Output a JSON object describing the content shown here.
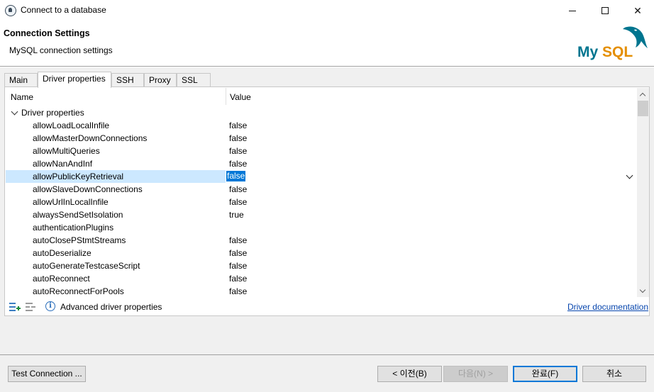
{
  "window": {
    "title": "Connect to a database",
    "minimize_icon": "minimize-icon",
    "maximize_icon": "maximize-icon",
    "close_label": "✕"
  },
  "header": {
    "title": "Connection Settings",
    "subtitle": "MySQL connection settings",
    "logo_text": "MySQL",
    "logo_colors": {
      "my": "#00758f",
      "sql": "#e48e00"
    }
  },
  "tabs": [
    {
      "label": "Main",
      "active": false
    },
    {
      "label": "Driver properties",
      "active": true
    },
    {
      "label": "SSH",
      "active": false
    },
    {
      "label": "Proxy",
      "active": false
    },
    {
      "label": "SSL",
      "active": false
    }
  ],
  "grid": {
    "columns": {
      "name": "Name",
      "value": "Value"
    },
    "group_label": "Driver properties",
    "rows": [
      {
        "name": "allowLoadLocalInfile",
        "value": "false"
      },
      {
        "name": "allowMasterDownConnections",
        "value": "false"
      },
      {
        "name": "allowMultiQueries",
        "value": "false"
      },
      {
        "name": "allowNanAndInf",
        "value": "false"
      },
      {
        "name": "allowPublicKeyRetrieval",
        "value": "false",
        "selected": true
      },
      {
        "name": "allowSlaveDownConnections",
        "value": "false"
      },
      {
        "name": "allowUrlInLocalInfile",
        "value": "false"
      },
      {
        "name": "alwaysSendSetIsolation",
        "value": "true"
      },
      {
        "name": "authenticationPlugins",
        "value": ""
      },
      {
        "name": "autoClosePStmtStreams",
        "value": "false"
      },
      {
        "name": "autoDeserialize",
        "value": "false"
      },
      {
        "name": "autoGenerateTestcaseScript",
        "value": "false"
      },
      {
        "name": "autoReconnect",
        "value": "false"
      },
      {
        "name": "autoReconnectForPools",
        "value": "false"
      }
    ]
  },
  "footer": {
    "advanced_label": "Advanced driver properties",
    "doc_link": "Driver documentation"
  },
  "buttons": {
    "test": "Test Connection ...",
    "back": "< 이전(B)",
    "next": "다음(N) >",
    "finish": "완료(F)",
    "cancel": "취소"
  },
  "colors": {
    "selection_row": "#cce8ff",
    "selection_value": "#0078d7",
    "link": "#0645ad",
    "add_icon": "#1a8a3c"
  }
}
